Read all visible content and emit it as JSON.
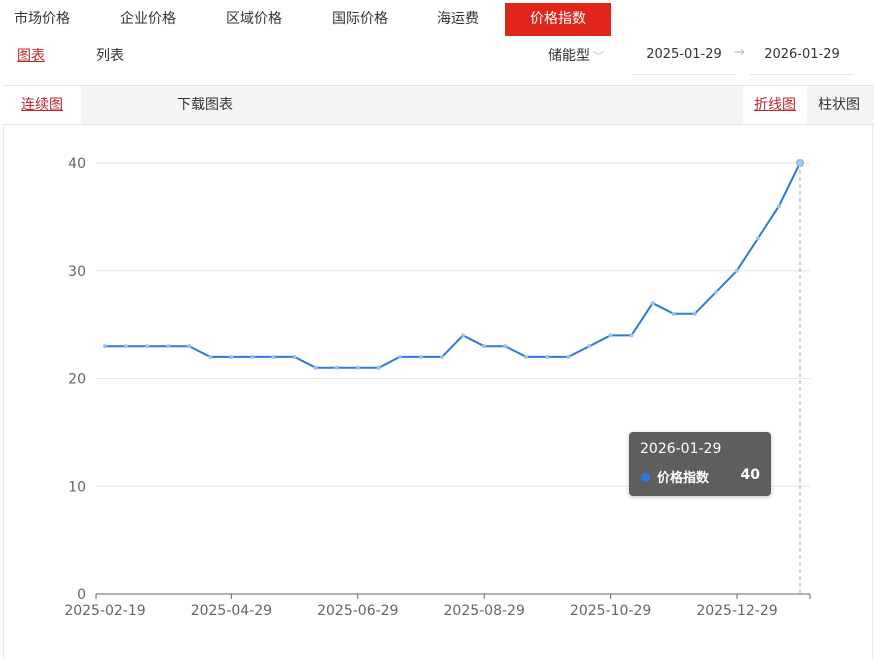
{
  "top_tabs": [
    "市场价格",
    "企业价格",
    "区域价格",
    "国际价格",
    "海运费",
    "价格指数"
  ],
  "sub_tabs": [
    "图表",
    "列表"
  ],
  "filter": {
    "type_select": "储能型",
    "start_date": "2025-01-29",
    "end_date": "2026-01-29"
  },
  "toolbar": {
    "continuous_chart": "连续图",
    "download_chart": "下载图表",
    "line_chart": "折线图",
    "bar_chart": "柱状图"
  },
  "colors": {
    "accent": "#e0251b",
    "active_link": "#c0272d",
    "series_line": "#2e7ad9"
  },
  "chart_data": {
    "type": "line",
    "x_ticks": [
      "2025-02-19",
      "2025-04-29",
      "2025-06-29",
      "2025-08-29",
      "2025-10-29",
      "2025-12-29"
    ],
    "y_ticks": [
      0,
      10,
      20,
      30,
      40
    ],
    "ylim": [
      0,
      40
    ],
    "grid": true,
    "series": [
      {
        "name": "价格指数",
        "values": [
          23,
          23,
          23,
          23,
          23,
          22,
          22,
          22,
          22,
          22,
          21,
          21,
          21,
          21,
          22,
          22,
          22,
          24,
          23,
          23,
          22,
          22,
          22,
          23,
          24,
          24,
          27,
          26,
          26,
          28,
          30,
          33,
          36,
          40
        ]
      }
    ]
  },
  "tooltip": {
    "date": "2026-01-29",
    "series_name": "价格指数",
    "value": "40"
  }
}
